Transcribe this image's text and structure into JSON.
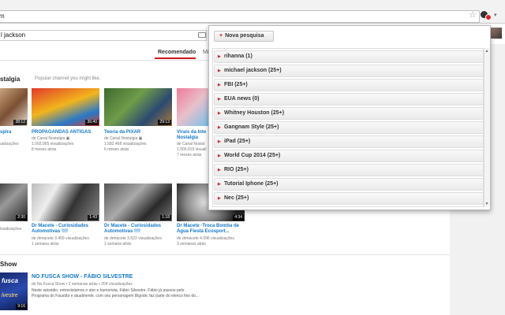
{
  "browser": {
    "omnibox_text": "m",
    "ext_badge": "",
    "colors": {
      "ext_badge": "#dd2222"
    }
  },
  "youtube": {
    "search_value": "l jackson",
    "tabs": {
      "recommended": "Recomendado",
      "other": "Mi"
    },
    "section1": {
      "title": "stalgia",
      "subtitle": "Popular channel you might like."
    },
    "row1": [
      {
        "dur": "38:12",
        "title": [
          "spira",
          ""
        ],
        "meta": [
          "ualizações",
          ""
        ]
      },
      {
        "dur": "36:40",
        "title": [
          "PROPAGANDAS ANTIGAS",
          ""
        ],
        "meta": [
          "de Canal Nostalgia ▣",
          "1.093.065 visualizações",
          "8 meses atrás"
        ]
      },
      {
        "dur": "",
        "title": [
          "",
          ""
        ],
        "meta": [
          "",
          "",
          ""
        ]
      },
      {
        "dur": "29:13",
        "title": [
          "Teoria da PIXAR",
          ""
        ],
        "meta": [
          "de Canal Nostalgia ▣",
          "1.582.468 visualizações",
          "6 meses atrás"
        ]
      },
      {
        "dur": "",
        "title": [
          "Virais da Inte",
          "Nostalgia"
        ],
        "meta": [
          "de Canal Nostal",
          "1.000.019 visuali",
          "7 meses atrás"
        ]
      }
    ],
    "row2": [
      {
        "dur": "2:30",
        "title": [
          "",
          ""
        ],
        "meta": [
          "isualizações",
          ""
        ]
      },
      {
        "dur": "1:43",
        "title": [
          "Dr Macete - Curiosidades",
          "Automotivas !!!!"
        ],
        "meta": [
          "de drmacete  3.459 visualizações",
          "1 semana atrás"
        ]
      },
      {
        "dur": "1:18",
        "title": [
          "Dr Macete - Curiosidades",
          "Automotivas !!!!"
        ],
        "meta": [
          "de drmacete  3.523 visualizações",
          "1 semana atrás"
        ]
      },
      {
        "dur": "4:34",
        "title": [
          "Dr Macete -Troca Bomba de",
          "Água Fiesta Ecosport..."
        ],
        "meta": [
          "de drmacete  4.096 visualizações",
          "3 semanas atrás"
        ]
      }
    ],
    "section3": {
      "title": "Show",
      "video_title": "NO FUSCA SHOW - FÁBIO SILVESTRE",
      "meta": "de No Fusca Show • 2 semanas atrás • 204 visualizações",
      "desc1": "Neste episódio, entrevistamos o ator e humorista, Fábio Silvestre. Fábio já passou pelo",
      "desc2": "Programa do Faustão e atualmente, com seu personagem Bigode, faz parte do elenco fixo do...",
      "dur": "9:16",
      "thumb_text": [
        "fusca",
        "lvestre"
      ]
    }
  },
  "popup": {
    "new_search_label": "Nova pesquisa",
    "items": [
      "rihanna (1)",
      "michael jackson (25+)",
      "FBI (25+)",
      "EUA news (0)",
      "Whitney Houston (25+)",
      "Gangnam Style (25+)",
      "iPad (25+)",
      "World Cup 2014 (25+)",
      "RIO (25+)",
      "Tutorial Iphone (25+)",
      "Nec (25+)"
    ],
    "colors": {
      "accent": "#cc181e"
    }
  }
}
